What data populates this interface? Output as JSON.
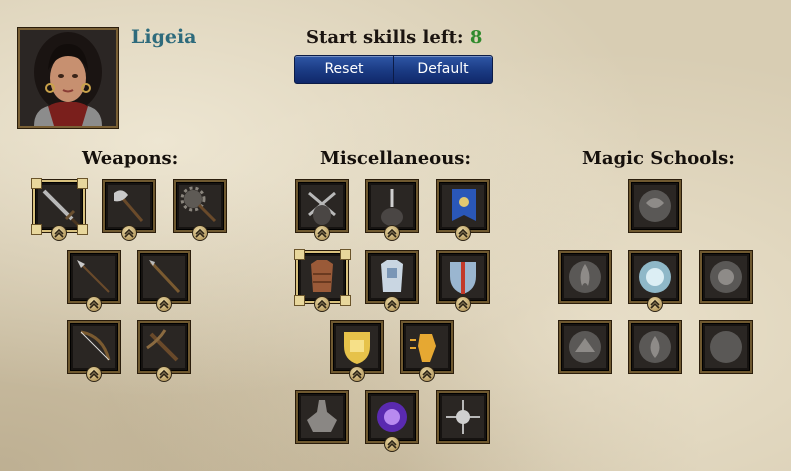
{
  "hero": {
    "name": "Ligeia"
  },
  "start_skills": {
    "label": "Start skills left:",
    "value": "8"
  },
  "buttons": {
    "reset": "Reset",
    "default": "Default"
  },
  "sections": {
    "weapons": "Weapons:",
    "misc": "Miscellaneous:",
    "magic": "Magic Schools:"
  },
  "skills": {
    "weapons": [
      "sword",
      "axe",
      "mace",
      "spear",
      "staff",
      "bow",
      "crossbow"
    ],
    "misc": [
      "dual-wield",
      "dagger-fighting",
      "leadership-banner",
      "leather-armor",
      "chain-armor",
      "shield",
      "block",
      "dodge",
      "unarmed",
      "spell-amplify",
      "mysticism"
    ],
    "magic": [
      "air-school",
      "fire-school",
      "water-school",
      "light-school",
      "earth-school",
      "nature-school",
      "dark-school"
    ]
  },
  "colors": {
    "hero_name": "#2e6b7c",
    "skills_number": "#2f8a2c",
    "button": "#1a3a82"
  }
}
